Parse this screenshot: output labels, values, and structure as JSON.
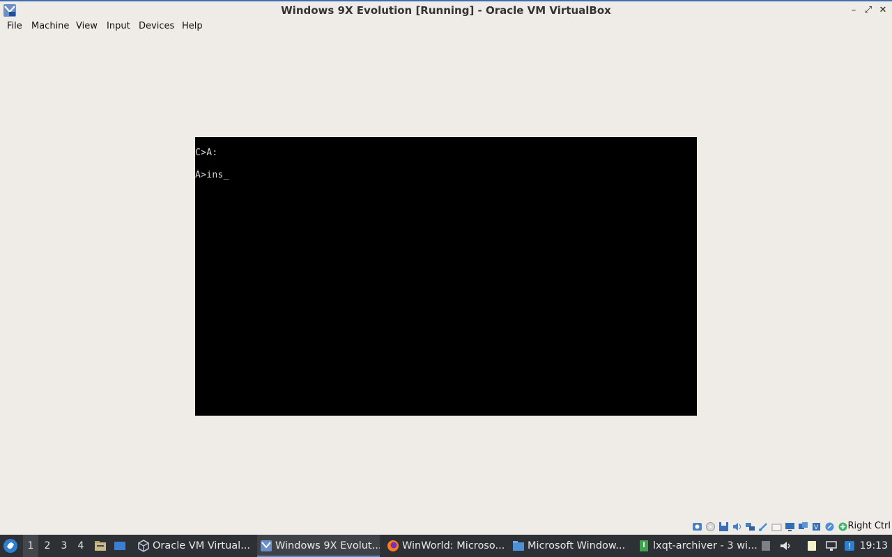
{
  "window": {
    "title": "Windows 9X Evolution [Running] - Oracle VM VirtualBox",
    "controls": {
      "minimize": "–",
      "maximize": "⤢",
      "close": "✕"
    }
  },
  "menubar": {
    "items": [
      "File",
      "Machine",
      "View",
      "Input",
      "Devices",
      "Help"
    ]
  },
  "vm_console": {
    "lines": [
      "C>A:",
      "A>ins_"
    ]
  },
  "statusbar": {
    "icons": [
      "hard-disk-icon",
      "optical-drive-icon",
      "floppy-drive-icon",
      "audio-icon",
      "network-icon",
      "usb-icon",
      "shared-folders-icon",
      "display-icon",
      "video-capture-icon",
      "cpu-icon",
      "mouse-integration-icon",
      "keyboard-icon"
    ],
    "host_key": "Right Ctrl"
  },
  "taskbar": {
    "workspaces": [
      "1",
      "2",
      "3",
      "4"
    ],
    "active_workspace": "1",
    "tasks": [
      {
        "label": "Oracle VM Virtual...",
        "icon": "virtualbox-icon"
      },
      {
        "label": "Windows 9X Evolut...",
        "icon": "vm-window-icon",
        "active": true
      },
      {
        "label": "WinWorld: Microso...",
        "icon": "firefox-icon"
      },
      {
        "label": "Microsoft Window...",
        "icon": "folder-icon"
      },
      {
        "label": "lxqt-archiver - 3 wi...",
        "icon": "archive-icon"
      }
    ],
    "clock": "19:13"
  },
  "colors": {
    "accent": "#3c6fb6",
    "taskbar_bg": "#2d3034",
    "window_bg": "#efece8",
    "vm_bg": "#000000"
  }
}
